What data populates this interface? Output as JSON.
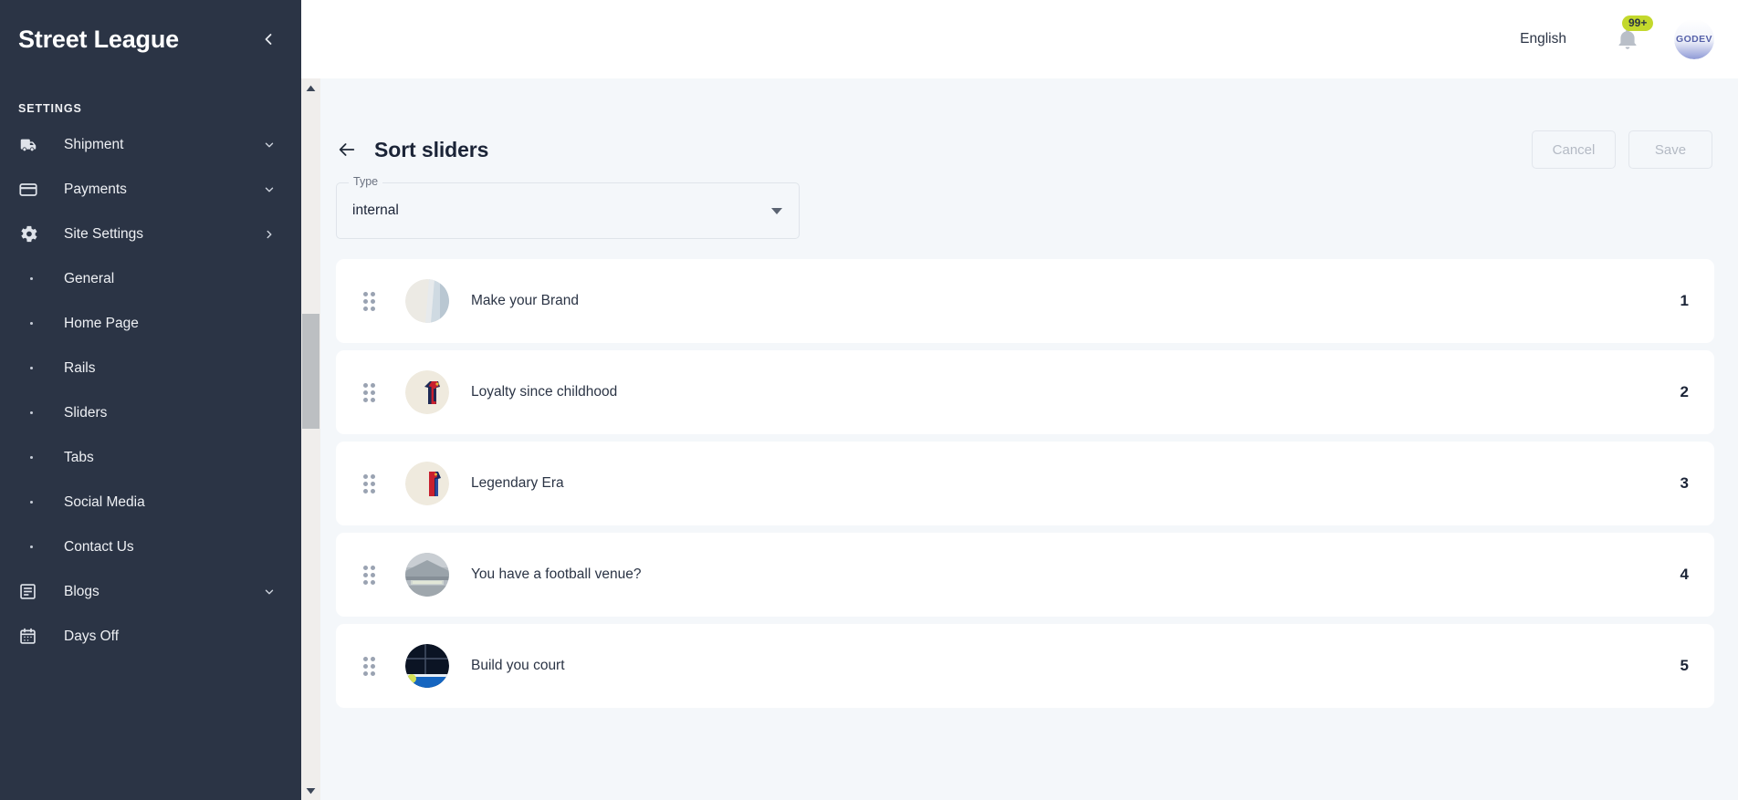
{
  "sidebar": {
    "brand": "Street League",
    "collapse_icon": "chevron-left-icon",
    "section_label": "SETTINGS",
    "items": [
      {
        "label": "Shipment",
        "icon": "truck-icon",
        "chevron": "chevron-down-icon",
        "type": "group"
      },
      {
        "label": "Payments",
        "icon": "credit-card-icon",
        "chevron": "chevron-down-icon",
        "type": "group"
      },
      {
        "label": "Site Settings",
        "icon": "gear-icon",
        "chevron": "chevron-right-icon",
        "type": "group"
      },
      {
        "label": "General",
        "type": "sub"
      },
      {
        "label": "Home Page",
        "type": "sub"
      },
      {
        "label": "Rails",
        "type": "sub"
      },
      {
        "label": "Sliders",
        "type": "sub"
      },
      {
        "label": "Tabs",
        "type": "sub"
      },
      {
        "label": "Social Media",
        "type": "sub"
      },
      {
        "label": "Contact Us",
        "type": "sub"
      },
      {
        "label": "Blogs",
        "icon": "article-icon",
        "chevron": "chevron-down-icon",
        "type": "group"
      },
      {
        "label": "Days Off",
        "icon": "calendar-icon",
        "type": "group"
      }
    ],
    "background_color": "#2b3445"
  },
  "topbar": {
    "language": "English",
    "bell_icon": "bell-icon",
    "notification_count": "99+",
    "badge_color": "#c3d82c",
    "avatar_label": "GODEV"
  },
  "page": {
    "back_icon": "arrow-left-icon",
    "title": "Sort sliders",
    "cancel_label": "Cancel",
    "save_label": "Save"
  },
  "type_select": {
    "label": "Type",
    "value": "internal",
    "caret_icon": "caret-down-icon"
  },
  "sliders": [
    {
      "title": "Make your Brand",
      "index": "1",
      "thumb": "brand-thumb",
      "thumb_color_a": "#eceae4",
      "thumb_color_b": "#c9d6df"
    },
    {
      "title": "Loyalty since childhood",
      "index": "2",
      "thumb": "jersey-thumb",
      "thumb_color_a": "#efeade",
      "thumb_color_b": "#e8e2d3"
    },
    {
      "title": "Legendary Era",
      "index": "3",
      "thumb": "legend-thumb",
      "thumb_color_a": "#efeade",
      "thumb_color_b": "#e8e2d3"
    },
    {
      "title": "You have a football venue?",
      "index": "4",
      "thumb": "stadium-thumb",
      "thumb_color_a": "#b9bfc4",
      "thumb_color_b": "#8f979f"
    },
    {
      "title": "Build you court",
      "index": "5",
      "thumb": "court-thumb",
      "thumb_color_a": "#0d1b33",
      "thumb_color_b": "#1565c0"
    }
  ],
  "scrollbar": {
    "up_arrow_icon": "scroll-up-arrow-icon",
    "down_arrow_icon": "scroll-down-arrow-icon",
    "thumb": "scrollbar-thumb"
  },
  "colors": {
    "content_bg": "#f4f7fa",
    "card_bg": "#ffffff",
    "sidebar_bg": "#2b3445",
    "accent": "#c3d82c"
  }
}
